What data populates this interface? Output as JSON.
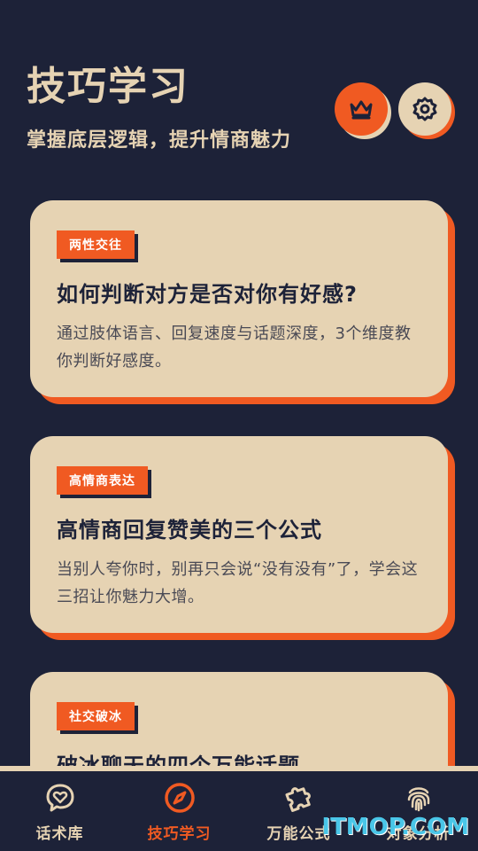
{
  "header": {
    "title": "技巧学习",
    "subtitle": "掌握底层逻辑，提升情商魅力"
  },
  "actions": {
    "vip_icon": "crown-icon",
    "settings_icon": "gear-icon"
  },
  "cards": [
    {
      "tag": "两性交往",
      "title": "如何判断对方是否对你有好感?",
      "desc": "通过肢体语言、回复速度与话题深度，3个维度教你判断好感度。"
    },
    {
      "tag": "高情商表达",
      "title": "高情商回复赞美的三个公式",
      "desc": "当别人夸你时，别再只会说“没有没有”了，学会这三招让你魅力大增。"
    },
    {
      "tag": "社交破冰",
      "title": "破冰聊天的四个万能话题",
      "desc": ""
    }
  ],
  "tabbar": {
    "items": [
      {
        "label": "话术库",
        "icon": "chat-heart-icon",
        "active": false
      },
      {
        "label": "技巧学习",
        "icon": "compass-icon",
        "active": true
      },
      {
        "label": "万能公式",
        "icon": "puzzle-icon",
        "active": false
      },
      {
        "label": "对象分析",
        "icon": "fingerprint-icon",
        "active": false
      }
    ]
  },
  "colors": {
    "background": "#1d2238",
    "cream": "#e6d3b3",
    "accent": "#f05a22"
  },
  "watermark": "ITMOP.COM"
}
